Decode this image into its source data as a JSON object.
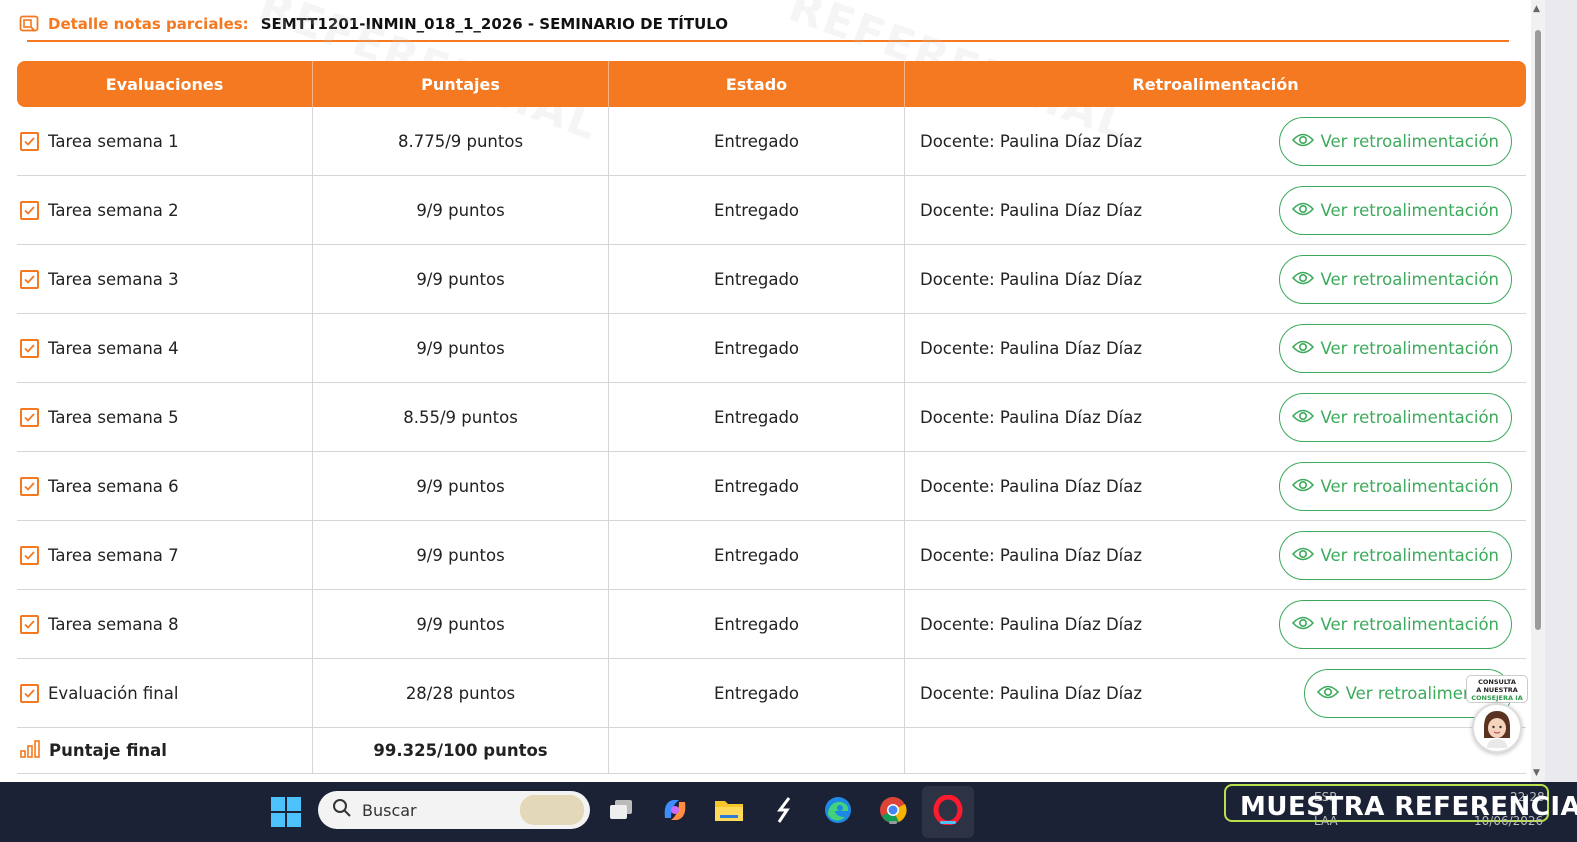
{
  "header": {
    "label": "Detalle notas parciales:",
    "course": "SEMTT1201-INMIN_018_1_2026 - SEMINARIO DE TÍTULO"
  },
  "table": {
    "columns": [
      "Evaluaciones",
      "Puntajes",
      "Estado",
      "Retroalimentación"
    ],
    "rows": [
      {
        "eval": "Tarea semana 1",
        "score": "8.775/9 puntos",
        "state": "Entregado",
        "teacher": "Docente: Paulina Díaz Díaz",
        "action": "Ver retroalimentación"
      },
      {
        "eval": "Tarea semana 2",
        "score": "9/9 puntos",
        "state": "Entregado",
        "teacher": "Docente: Paulina Díaz Díaz",
        "action": "Ver retroalimentación"
      },
      {
        "eval": "Tarea semana 3",
        "score": "9/9 puntos",
        "state": "Entregado",
        "teacher": "Docente: Paulina Díaz Díaz",
        "action": "Ver retroalimentación"
      },
      {
        "eval": "Tarea semana 4",
        "score": "9/9 puntos",
        "state": "Entregado",
        "teacher": "Docente: Paulina Díaz Díaz",
        "action": "Ver retroalimentación"
      },
      {
        "eval": "Tarea semana 5",
        "score": "8.55/9 puntos",
        "state": "Entregado",
        "teacher": "Docente: Paulina Díaz Díaz",
        "action": "Ver retroalimentación"
      },
      {
        "eval": "Tarea semana 6",
        "score": "9/9 puntos",
        "state": "Entregado",
        "teacher": "Docente: Paulina Díaz Díaz",
        "action": "Ver retroalimentación"
      },
      {
        "eval": "Tarea semana 7",
        "score": "9/9 puntos",
        "state": "Entregado",
        "teacher": "Docente: Paulina Díaz Díaz",
        "action": "Ver retroalimentación"
      },
      {
        "eval": "Tarea semana 8",
        "score": "9/9 puntos",
        "state": "Entregado",
        "teacher": "Docente: Paulina Díaz Díaz",
        "action": "Ver retroalimentación"
      },
      {
        "eval": "Evaluación final",
        "score": "28/28 puntos",
        "state": "Entregado",
        "teacher": "Docente: Paulina Díaz Díaz",
        "action": "Ver retroalimentac"
      }
    ],
    "final": {
      "label": "Puntaje final",
      "score": "99.325/100 puntos"
    }
  },
  "assistant": {
    "line1": "CONSULTA",
    "line2": "A NUESTRA",
    "line3": "CONSEJERA IA"
  },
  "taskbar": {
    "search_placeholder": "Buscar",
    "tray_text": "MUESTRA REFERENCIAL",
    "lang": "ESP",
    "layout": "LAA",
    "time": "22:28",
    "date": "10/06/2026"
  },
  "watermark": "REFERENCIAL",
  "colors": {
    "accent": "#f47920",
    "feedback": "#3daa5c",
    "taskbar": "#1c2236"
  }
}
